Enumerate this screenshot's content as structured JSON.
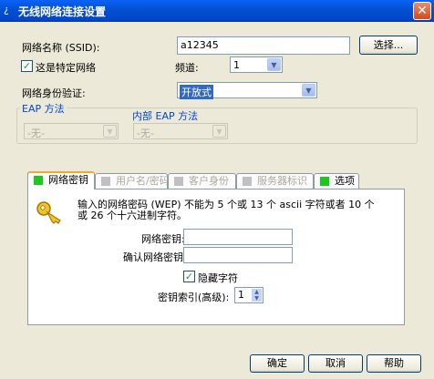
{
  "window": {
    "title": "无线网络连接设置",
    "close_glyph": "✕",
    "title_glyph": "¿"
  },
  "ssid": {
    "label": "网络名称 (SSID):",
    "value": "a12345",
    "browse_label": "选择..."
  },
  "specific_network": {
    "label": "这是特定网络",
    "checked": true
  },
  "channel": {
    "label": "频道:",
    "value": "1"
  },
  "auth": {
    "label": "网络身份验证:",
    "value": "开放式"
  },
  "eap": {
    "label": "EAP 方法",
    "value": "-无-"
  },
  "inner_eap": {
    "label": "内部 EAP 方法",
    "value": "-无-"
  },
  "tabs": [
    {
      "label": "网络密钥",
      "active": true,
      "disabled": false,
      "color": "#1dc81d"
    },
    {
      "label": "用户名/密码",
      "active": false,
      "disabled": true,
      "color": "#c0c0c0"
    },
    {
      "label": "客户身份",
      "active": false,
      "disabled": true,
      "color": "#c0c0c0"
    },
    {
      "label": "服务器标识",
      "active": false,
      "disabled": true,
      "color": "#c0c0c0"
    },
    {
      "label": "选项",
      "active": false,
      "disabled": false,
      "color": "#1dc81d"
    }
  ],
  "key_panel": {
    "icon": "key-icon",
    "description_line1": "输入的网络密码 (WEP) 不能为 5 个或 13 个 ascii 字符或者 10 个",
    "description_line2": "或 26 个十六进制字符。",
    "network_key_label": "网络密钥:",
    "network_key_value": "",
    "confirm_key_label": "确认网络密钥:",
    "confirm_key_value": "",
    "hide_chars_label": "隐藏字符",
    "hide_chars_checked": true,
    "key_index_label": "密钥索引(高级):",
    "key_index_value": "1"
  },
  "buttons": {
    "ok": "确定",
    "cancel": "取消",
    "help": "帮助"
  }
}
